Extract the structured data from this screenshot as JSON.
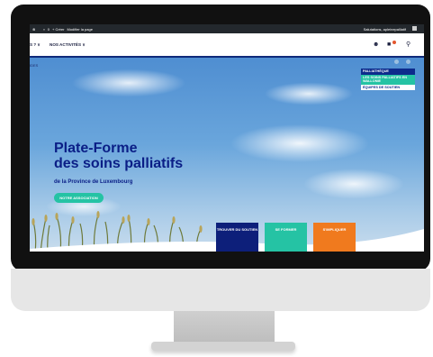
{
  "admin_bar": {
    "item_counter": "0",
    "item_new": "+ Créer",
    "item_edit": "Modifier la page",
    "user_greeting": "Salutations, apleinepalliatif"
  },
  "nav": {
    "item_partial": "S ? ∨",
    "item_activities": "NOS ACTIVITÉS ∨"
  },
  "hero": {
    "crumb": "IDES",
    "title_line1": "Plate-Forme",
    "title_line2": "des soins palliatifs",
    "subtitle": "de la Province de Luxembourg",
    "button_association": "NOTRE ASSOCIATION"
  },
  "side_menu": {
    "items": [
      "PALLIATHÈQUE",
      "LES SOINS PALLIATIFS EN WALLONIE",
      "ÉQUIPES DE SOUTIEN"
    ]
  },
  "cards": [
    {
      "label": "TROUVER DU SOUTIEN"
    },
    {
      "label": "SE FORMER"
    },
    {
      "label": "S'IMPLIQUER"
    }
  ],
  "colors": {
    "primary_navy": "#0a1e86",
    "accent_teal": "#25c3a4",
    "accent_orange": "#f07a1e"
  },
  "icons": [
    "user-add-icon",
    "cart-icon",
    "search-icon",
    "wordpress-logo-icon"
  ]
}
